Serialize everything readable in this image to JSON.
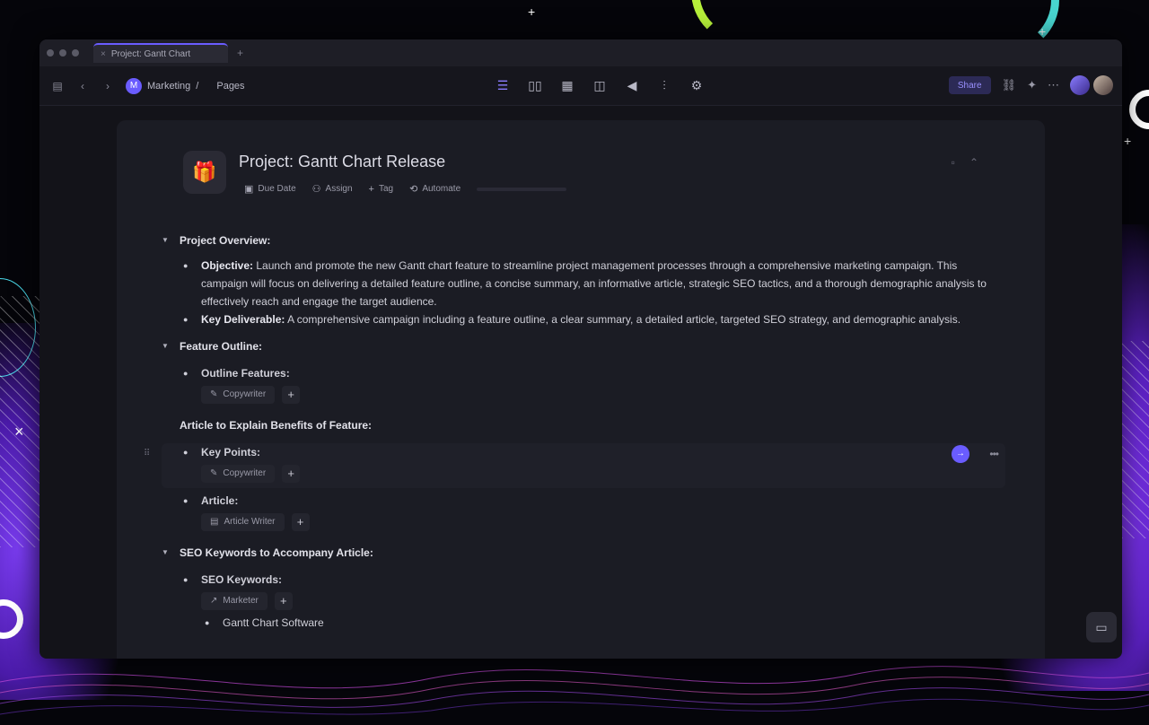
{
  "browser": {
    "tab_title": "Project: Gantt Chart",
    "tab_close": "×",
    "tab_new": "+"
  },
  "toolbar": {
    "workspace_initial": "M",
    "workspace_name": "Marketing",
    "breadcrumb_sep": "/",
    "breadcrumb_page": "Pages",
    "share_label": "Share"
  },
  "doc": {
    "icon": "🎁",
    "title": "Project: Gantt Chart Release",
    "actions": {
      "due_date": "Due Date",
      "assign": "Assign",
      "tag": "Tag",
      "automate": "Automate"
    }
  },
  "content": {
    "project_overview": {
      "heading": "Project Overview:",
      "objective_label": "Objective:",
      "objective_text": " Launch and promote the new Gantt chart feature to streamline project management processes through a comprehensive marketing campaign. This campaign will focus on delivering a detailed feature outline, a concise summary, an informative article, strategic SEO tactics, and a thorough demographic analysis to effectively reach and engage the target audience.",
      "deliverable_label": "Key Deliverable:",
      "deliverable_text": " A comprehensive campaign including a feature outline, a clear summary, a detailed article, targeted SEO strategy, and demographic analysis."
    },
    "feature_outline": {
      "heading": "Feature Outline:",
      "outline_label": "Outline Features:",
      "chip": "Copywriter"
    },
    "article": {
      "heading": "Article to Explain Benefits of Feature:",
      "key_points_label": "Key Points:",
      "key_points_chip": "Copywriter",
      "article_label": "Article:",
      "article_chip": "Article Writer"
    },
    "seo": {
      "heading": "SEO Keywords to Accompany Article:",
      "keywords_label": "SEO Keywords:",
      "chip": "Marketer",
      "keyword_1": "Gantt Chart Software"
    }
  },
  "icons": {
    "add": "+",
    "run": "→",
    "more": "•••"
  },
  "colors": {
    "accent": "#6a5cff",
    "panel": "#1b1c24",
    "window": "#131319"
  }
}
